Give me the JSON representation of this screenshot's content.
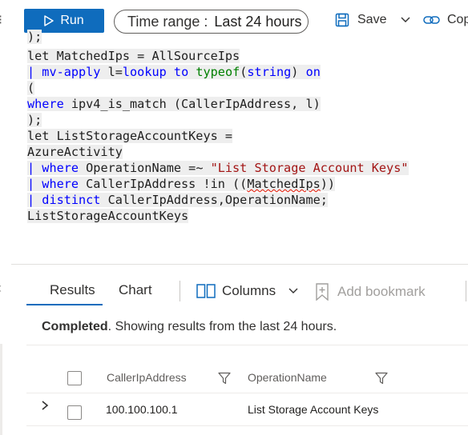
{
  "toolbar": {
    "run_label": "Run",
    "time_range_label": "Time range :",
    "time_range_value": "Last 24 hours",
    "save_label": "Save",
    "copy_label": "Copy",
    "accent_color": "#0f6cbd"
  },
  "editor": {
    "lines": [
      ");",
      "let MatchedIps = AllSourceIps",
      "| mv-apply l=lookup to typeof(string) on",
      "(",
      "where ipv4_is_match (CallerIpAddress, l)",
      ");",
      "let ListStorageAccountKeys =",
      "AzureActivity",
      "| where OperationName =~ \"List Storage Account Keys\"",
      "| where CallerIpAddress !in ((MatchedIps))",
      "| distinct CallerIpAddress,OperationName;",
      "ListStorageAccountKeys"
    ]
  },
  "results": {
    "tabs": [
      {
        "label": "Results",
        "active": true
      },
      {
        "label": "Chart",
        "active": false
      }
    ],
    "columns_label": "Columns",
    "bookmark_label": "Add bookmark",
    "status_bold": "Completed",
    "status_text": ". Showing results from the last 24 hours.",
    "columns": [
      "CallerIpAddress",
      "OperationName"
    ],
    "rows": [
      {
        "CallerIpAddress": "100.100.100.1",
        "OperationName": "List Storage Account Keys"
      }
    ]
  }
}
